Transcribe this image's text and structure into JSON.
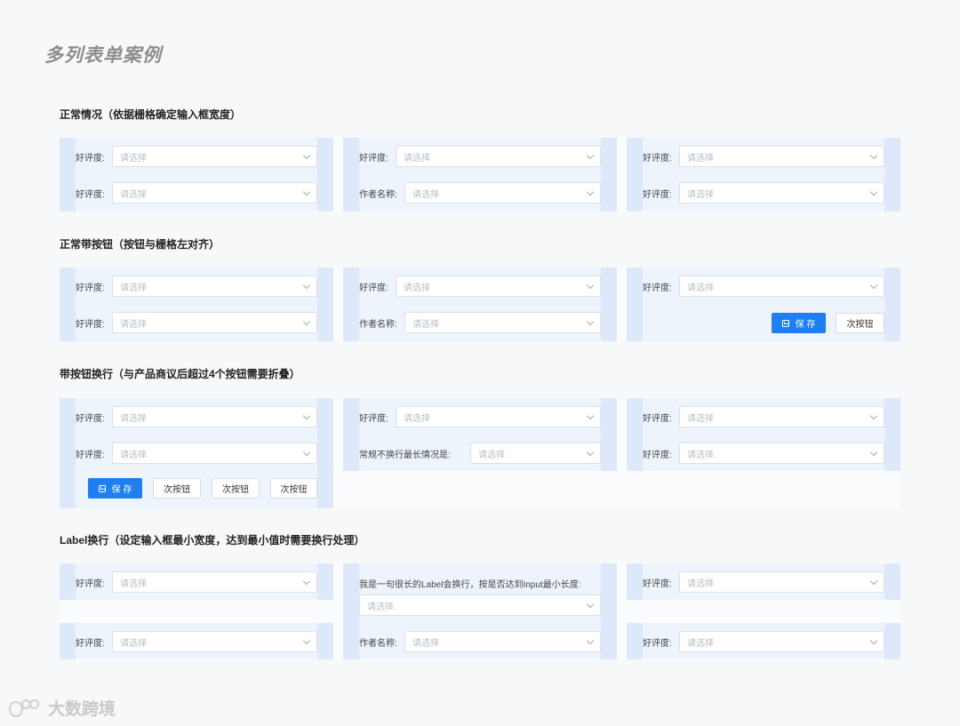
{
  "page_title": "多列表单案例",
  "placeholder": "请选择",
  "labels": {
    "good_rating": "好评度:",
    "author_name": "作者名称:",
    "long_label": "常规不换行最长情况是:",
    "wrapped_label": "我是一句很长的Label会换行，按是否达到Input最小长度:"
  },
  "buttons": {
    "save": "保 存",
    "secondary": "次按钮"
  },
  "sections": [
    {
      "title": "正常情况（依据栅格确定输入框宽度）"
    },
    {
      "title": "正常带按钮（按钮与栅格左对齐）"
    },
    {
      "title": "带按钮换行（与产品商议后超过4个按钮需要折叠）"
    },
    {
      "title": "Label换行（设定输入框最小宽度，达到最小值时需要换行处理）"
    }
  ],
  "watermark": "大数跨境",
  "colors": {
    "primary": "#1d7ff0",
    "gutter": "#dde9fb",
    "column": "#eef4fc"
  },
  "icons": [
    "chevron-down-icon",
    "save-icon"
  ]
}
